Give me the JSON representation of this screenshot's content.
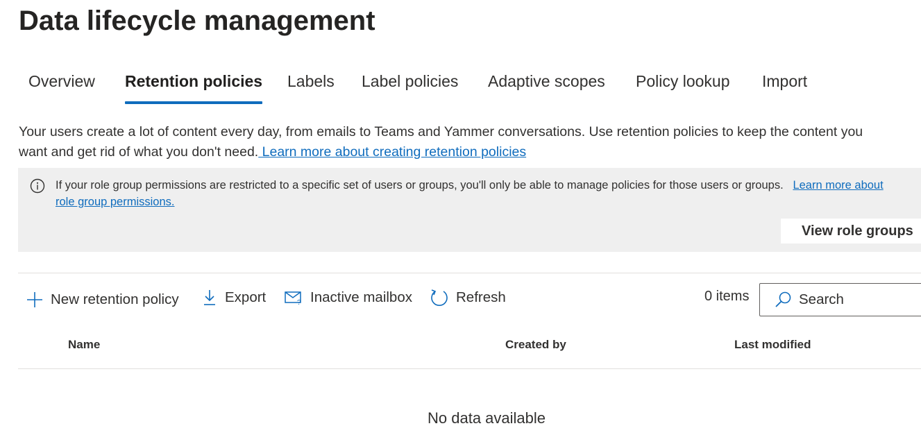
{
  "page": {
    "title": "Data lifecycle management"
  },
  "tabs": [
    {
      "label": "Overview",
      "active": false
    },
    {
      "label": "Retention policies",
      "active": true
    },
    {
      "label": "Labels",
      "active": false
    },
    {
      "label": "Label policies",
      "active": false
    },
    {
      "label": "Adaptive scopes",
      "active": false
    },
    {
      "label": "Policy lookup",
      "active": false
    },
    {
      "label": "Import",
      "active": false
    }
  ],
  "description": {
    "line1": "Your users create a lot of content every day, from emails to Teams and Yammer conversations. Use retention policies to keep the content you",
    "line2": "want and get rid of what you don't need.",
    "link": " Learn more about creating retention policies"
  },
  "info_bar": {
    "icon": "info-icon",
    "text": "If your role group permissions are restricted to a specific set of users or groups, you'll only be able to manage policies for those users or groups.",
    "link": "Learn more about role group permissions.",
    "button_label": "View role groups"
  },
  "toolbar": {
    "new_policy": {
      "label": "New retention policy",
      "icon": "plus-icon"
    },
    "export": {
      "label": "Export",
      "icon": "download-icon"
    },
    "inactive_mailbox": {
      "label": "Inactive mailbox",
      "icon": "mailbox-icon"
    },
    "refresh": {
      "label": "Refresh",
      "icon": "refresh-icon"
    },
    "items_count": "0 items",
    "search_placeholder": "Search"
  },
  "table": {
    "columns": [
      "Name",
      "Created by",
      "Last modified"
    ],
    "rows": [],
    "empty_text": "No data available"
  },
  "colors": {
    "accent": "#0f6cbd",
    "info_bg": "#efefef",
    "text": "#323130"
  }
}
